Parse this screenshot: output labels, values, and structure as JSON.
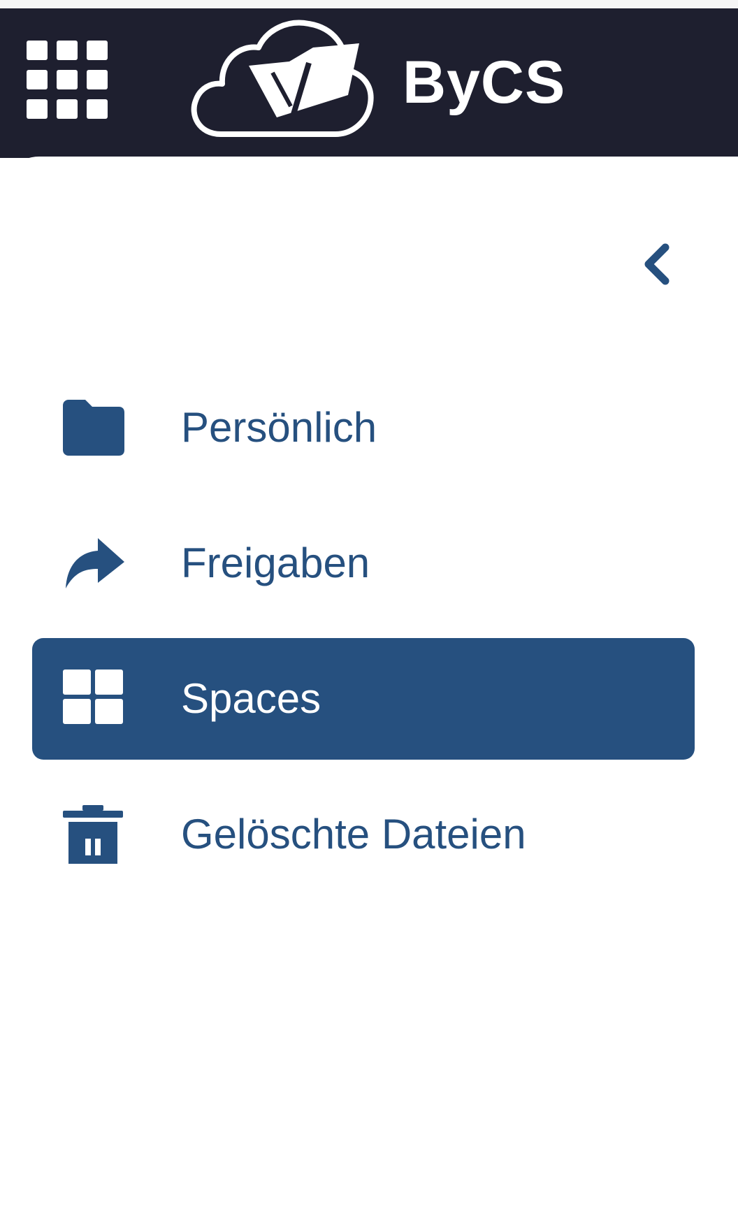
{
  "header": {
    "logo_text": "ByCS",
    "apps_icon": "grid-icon",
    "logo_icon": "cloud-folder-logo",
    "background_color": "#1e1f2f"
  },
  "sidebar": {
    "collapse_icon": "chevron-left-icon",
    "accent_color": "#26507f",
    "items": [
      {
        "label": "Persönlich",
        "icon": "folder-icon",
        "active": false
      },
      {
        "label": "Freigaben",
        "icon": "share-icon",
        "active": false
      },
      {
        "label": "Spaces",
        "icon": "spaces-grid-icon",
        "active": true
      },
      {
        "label": "Gelöschte Dateien",
        "icon": "trash-icon",
        "active": false
      }
    ]
  }
}
